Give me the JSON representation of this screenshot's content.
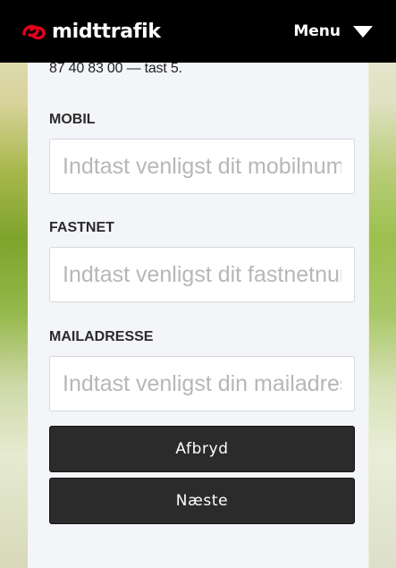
{
  "header": {
    "logo_text": "midttrafik",
    "menu_label": "Menu"
  },
  "form": {
    "top_text": "87 40 83 00 — tast 5.",
    "mobile": {
      "label": "MOBIL",
      "placeholder": "Indtast venligst dit mobilnummer",
      "value": ""
    },
    "landline": {
      "label": "FASTNET",
      "placeholder": "Indtast venligst dit fastnetnummer",
      "value": ""
    },
    "email": {
      "label": "MAILADRESSE",
      "placeholder": "Indtast venligst din mailadresse",
      "value": ""
    },
    "cancel_label": "Afbryd",
    "next_label": "Næste"
  },
  "colors": {
    "header_bg": "#000000",
    "logo_accent": "#e3001b",
    "button_bg": "#2b2b2b",
    "panel_bg": "#f3f5f8"
  },
  "icons": {
    "logo": "midttrafik-logo-icon",
    "menu": "caret-down-icon"
  }
}
